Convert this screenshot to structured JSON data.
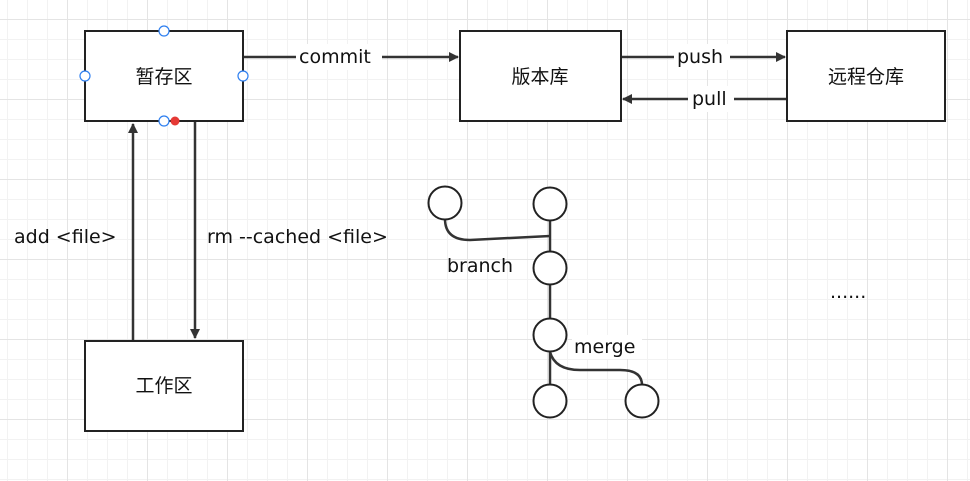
{
  "boxes": {
    "staging": "暂存区",
    "repository": "版本库",
    "remote": "远程仓库",
    "working": "工作区"
  },
  "edges": {
    "commit": "commit",
    "push": "push",
    "pull": "pull",
    "add": "add <file>",
    "rm_cached": "rm --cached <file>"
  },
  "branch_diagram": {
    "branch": "branch",
    "merge": "merge"
  },
  "ellipsis": "......",
  "colors": {
    "selection_handle": "#2e7ff0",
    "connection_point": "#e53935"
  }
}
